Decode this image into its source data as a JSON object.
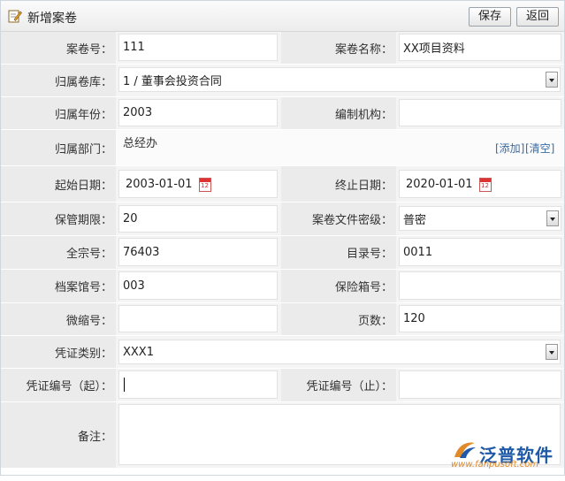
{
  "header": {
    "title": "新增案卷",
    "save_label": "保存",
    "back_label": "返回",
    "icon": "edit-icon"
  },
  "form": {
    "case_no": {
      "label": "案卷号：",
      "value": "111"
    },
    "case_name": {
      "label": "案卷名称：",
      "value": "XX项目资料"
    },
    "archive_lib": {
      "label": "归属卷库：",
      "value": "1 / 董事会投资合同"
    },
    "year": {
      "label": "归属年份：",
      "value": "2003"
    },
    "org": {
      "label": "编制机构：",
      "value": ""
    },
    "dept": {
      "label": "归属部门：",
      "value": "总经办",
      "add_link": "[添加]",
      "clear_link": "[清空]"
    },
    "start_date": {
      "label": "起始日期：",
      "value": "2003-01-01"
    },
    "end_date": {
      "label": "终止日期：",
      "value": "2020-01-01"
    },
    "period": {
      "label": "保管期限：",
      "value": "20"
    },
    "secret": {
      "label": "案卷文件密级：",
      "value": "普密"
    },
    "fonds_no": {
      "label": "全宗号：",
      "value": "76403"
    },
    "catalog_no": {
      "label": "目录号：",
      "value": "0011"
    },
    "archive_code": {
      "label": "档案馆号：",
      "value": "003"
    },
    "safe_box": {
      "label": "保险箱号：",
      "value": ""
    },
    "microfilm": {
      "label": "微缩号：",
      "value": ""
    },
    "pages": {
      "label": "页数：",
      "value": "120"
    },
    "voucher_type": {
      "label": "凭证类别：",
      "value": "XXX1"
    },
    "voucher_start": {
      "label": "凭证编号（起）：",
      "value": ""
    },
    "voucher_end": {
      "label": "凭证编号（止）：",
      "value": ""
    },
    "remark": {
      "label": "备注：",
      "value": ""
    }
  },
  "brand": {
    "name": "泛普软件",
    "url": "www.fanpusoft.com"
  },
  "colors": {
    "label_bg": "#ebebeb",
    "cell_bg": "#f4f4f4",
    "link": "#3b6aa3",
    "brand": "#1e5aa8"
  }
}
